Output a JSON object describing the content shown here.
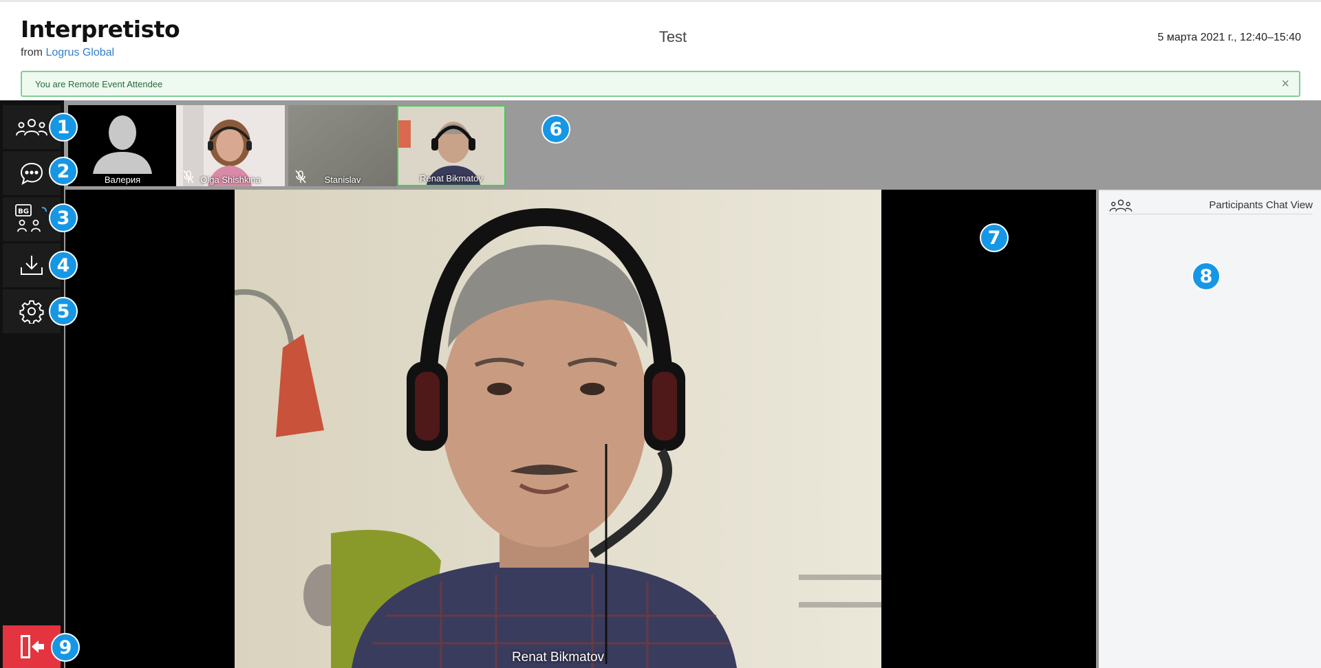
{
  "app": {
    "name": "Interpretisto",
    "from_label": "from",
    "from_link": "Logrus Global"
  },
  "event": {
    "title": "Test",
    "datetime": "5 марта 2021 г., 12:40–15:40"
  },
  "alert": {
    "message": "You are Remote Event Attendee",
    "close_glyph": "×"
  },
  "sidebar": {
    "items": [
      {
        "name": "participants",
        "icon": "participants-icon",
        "badge": "1"
      },
      {
        "name": "chat",
        "icon": "chat-icon",
        "badge": "2"
      },
      {
        "name": "language",
        "icon": "language-participants-icon",
        "label": "BG",
        "badge": "3"
      },
      {
        "name": "download",
        "icon": "download-icon",
        "badge": "4"
      },
      {
        "name": "settings",
        "icon": "gear-icon",
        "badge": "5"
      }
    ],
    "exit": {
      "icon": "exit-door-icon",
      "badge": "9"
    }
  },
  "thumbnails": [
    {
      "name": "Валерия",
      "muted": false,
      "active": false
    },
    {
      "name": "Olga Shishkina",
      "muted": true,
      "active": false
    },
    {
      "name": "Stanislav",
      "muted": true,
      "active": false
    },
    {
      "name": "Renat Bikmatov",
      "muted": false,
      "active": true
    }
  ],
  "annotations": {
    "thumbnails": "6",
    "main_video": "7",
    "chat_panel": "8"
  },
  "main_video": {
    "speaker": "Renat Bikmatov"
  },
  "chat_panel": {
    "title": "Participants Chat View",
    "icon": "participants-icon"
  },
  "colors": {
    "accent": "#1697e6",
    "exit": "#e3343f",
    "active_border": "#3ecf4e",
    "alert_border": "#7fcf93",
    "link": "#2f7fc9"
  }
}
